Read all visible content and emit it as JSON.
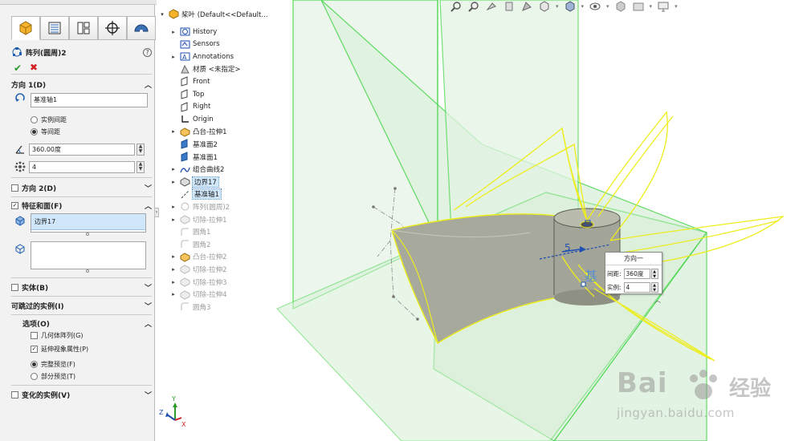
{
  "property_manager": {
    "tabs": [
      {
        "icon": "feature-manager-icon"
      },
      {
        "icon": "property-manager-icon"
      },
      {
        "icon": "configuration-manager-icon"
      },
      {
        "icon": "dim-xpert-icon"
      },
      {
        "icon": "display-manager-icon"
      }
    ],
    "title": "阵列(圆周)2",
    "help": "?",
    "ok_glyph": "✔",
    "cancel_glyph": "✖",
    "direction1": {
      "label": "方向 1(D)",
      "axis_value": "基准轴1",
      "radio_instance_spacing": "实例间距",
      "radio_equal_spacing": "等间距",
      "selected_radio": "等间距",
      "angle_value": "360.00度",
      "count_value": "4"
    },
    "direction2": {
      "label": "方向 2(D)",
      "checked": false
    },
    "features_faces": {
      "label": "特征和面(F)",
      "checked": true,
      "selected_item": "边界17"
    },
    "solid_bodies": {
      "label": "实体(B)",
      "checked": false
    },
    "instances_to_skip": {
      "label": "可跳过的实例(I)"
    },
    "options": {
      "label": "选项(O)",
      "geometry_pattern": {
        "label": "几何体阵列(G)",
        "checked": false
      },
      "propagate_visual": {
        "label": "延伸视象属性(P)",
        "checked": true
      },
      "full_preview": {
        "label": "完整预览(F)",
        "selected": true
      },
      "partial_preview": {
        "label": "部分预览(T)",
        "selected": false
      }
    },
    "varying_instances": {
      "label": "变化的实例(V)",
      "checked": false
    }
  },
  "feature_tree": {
    "root": "桨叶  (Default<<Default...",
    "items": [
      {
        "label": "History",
        "icon": "history-folder-icon",
        "expandable": true,
        "dim": false
      },
      {
        "label": "Sensors",
        "icon": "sensors-icon",
        "expandable": false,
        "dim": false
      },
      {
        "label": "Annotations",
        "icon": "annotations-icon",
        "expandable": true,
        "dim": false
      },
      {
        "label": "材质 <未指定>",
        "icon": "material-icon",
        "expandable": false,
        "dim": false
      },
      {
        "label": "Front",
        "icon": "plane-icon",
        "expandable": false,
        "dim": false
      },
      {
        "label": "Top",
        "icon": "plane-icon",
        "expandable": false,
        "dim": false
      },
      {
        "label": "Right",
        "icon": "plane-icon",
        "expandable": false,
        "dim": false
      },
      {
        "label": "Origin",
        "icon": "origin-icon",
        "expandable": false,
        "dim": false
      },
      {
        "label": "凸台-拉伸1",
        "icon": "boss-extrude-icon",
        "expandable": true,
        "dim": false
      },
      {
        "label": "基准面2",
        "icon": "plane-solid-icon",
        "expandable": false,
        "dim": false
      },
      {
        "label": "基准面1",
        "icon": "plane-solid-icon",
        "expandable": false,
        "dim": false
      },
      {
        "label": "组合曲线2",
        "icon": "composite-curve-icon",
        "expandable": true,
        "dim": false
      },
      {
        "label": "边界17",
        "icon": "boundary-surface-icon",
        "expandable": true,
        "dim": false,
        "highlight": true
      },
      {
        "label": "基准轴1",
        "icon": "axis-icon",
        "expandable": false,
        "dim": false,
        "highlight": true
      },
      {
        "label": "阵列(圆周)2",
        "icon": "circular-pattern-icon",
        "expandable": true,
        "dim": true
      },
      {
        "label": "切除-拉伸1",
        "icon": "cut-extrude-icon",
        "expandable": true,
        "dim": true
      },
      {
        "label": "圆角1",
        "icon": "fillet-icon",
        "expandable": false,
        "dim": true
      },
      {
        "label": "圆角2",
        "icon": "fillet-icon",
        "expandable": false,
        "dim": true
      },
      {
        "label": "凸台-拉伸2",
        "icon": "boss-extrude-icon",
        "expandable": true,
        "dim": true
      },
      {
        "label": "切除-拉伸2",
        "icon": "cut-extrude-icon",
        "expandable": true,
        "dim": true
      },
      {
        "label": "切除-拉伸3",
        "icon": "cut-extrude-icon",
        "expandable": true,
        "dim": true
      },
      {
        "label": "切除-拉伸4",
        "icon": "cut-extrude-icon",
        "expandable": true,
        "dim": true
      },
      {
        "label": "圆角3",
        "icon": "fillet-icon",
        "expandable": false,
        "dim": true
      }
    ]
  },
  "toolbar": {
    "icons": [
      "zoom-to-fit-icon",
      "zoom-area-icon",
      "previous-view-icon",
      "section-view-icon",
      "dynamic-annotation-icon",
      "view-orientation-icon",
      "display-style-icon",
      "hide-show-icon",
      "edit-appearance-icon",
      "apply-scene-icon",
      "view-settings-icon"
    ]
  },
  "viewport": {
    "dim_label": "5",
    "axis_tag": "基",
    "popup": {
      "title": "方向一",
      "spacing_label": "间距:",
      "spacing_value": "360度",
      "count_label": "实例:",
      "count_value": "4"
    },
    "triad": {
      "y": "Y",
      "z": "Z",
      "x": "X"
    }
  },
  "watermark": {
    "brand": "Bai",
    "brand_cn": "经验",
    "url": "jingyan.baidu.com"
  },
  "colors": {
    "plane_fill": "#dff2df",
    "plane_edge": "#46d64a",
    "highlight_yellow": "#eded1c",
    "body_gray": "#a6a99c",
    "selection_blue": "#cfe6fb"
  }
}
